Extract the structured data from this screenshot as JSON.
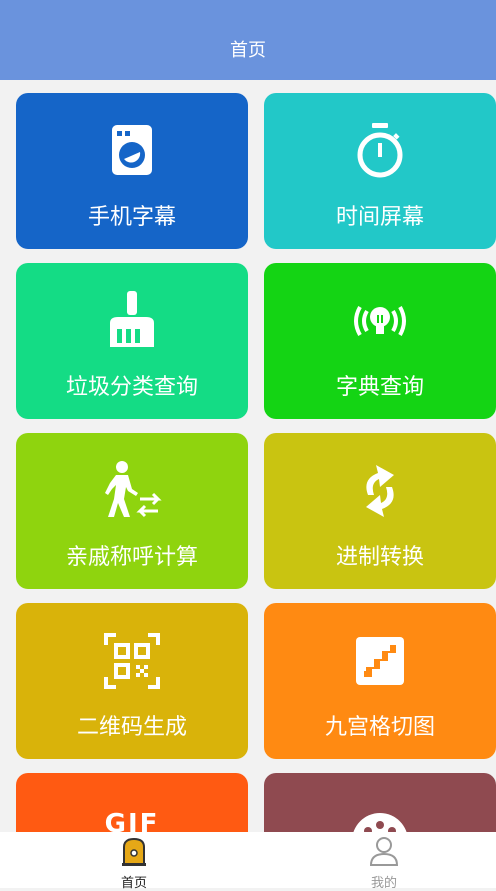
{
  "header": {
    "title": "首页"
  },
  "tiles": [
    {
      "label": "手机字幕",
      "color": "#1565c8",
      "icon": "washing-machine-icon"
    },
    {
      "label": "时间屏幕",
      "color": "#22c8c8",
      "icon": "stopwatch-icon"
    },
    {
      "label": "垃圾分类查询",
      "color": "#14dc85",
      "icon": "broom-icon"
    },
    {
      "label": "字典查询",
      "color": "#14d414",
      "icon": "lightbulb-signal-icon"
    },
    {
      "label": "亲戚称呼计算",
      "color": "#8fd40e",
      "icon": "walking-person-arrows-icon"
    },
    {
      "label": "进制转换",
      "color": "#c9c411",
      "icon": "swap-arrows-icon"
    },
    {
      "label": "二维码生成",
      "color": "#d9b30a",
      "icon": "qr-code-icon"
    },
    {
      "label": "九宫格切图",
      "color": "#ff8a12",
      "icon": "stairs-icon"
    },
    {
      "label": "GIF",
      "color": "#ff5a12",
      "icon": "gif-icon"
    },
    {
      "label": "",
      "color": "#8f4a50",
      "icon": "palette-icon"
    }
  ],
  "tabbar": {
    "home_label": "首页",
    "mine_label": "我的",
    "active_color": "#e6a817",
    "inactive_color": "#999999"
  }
}
